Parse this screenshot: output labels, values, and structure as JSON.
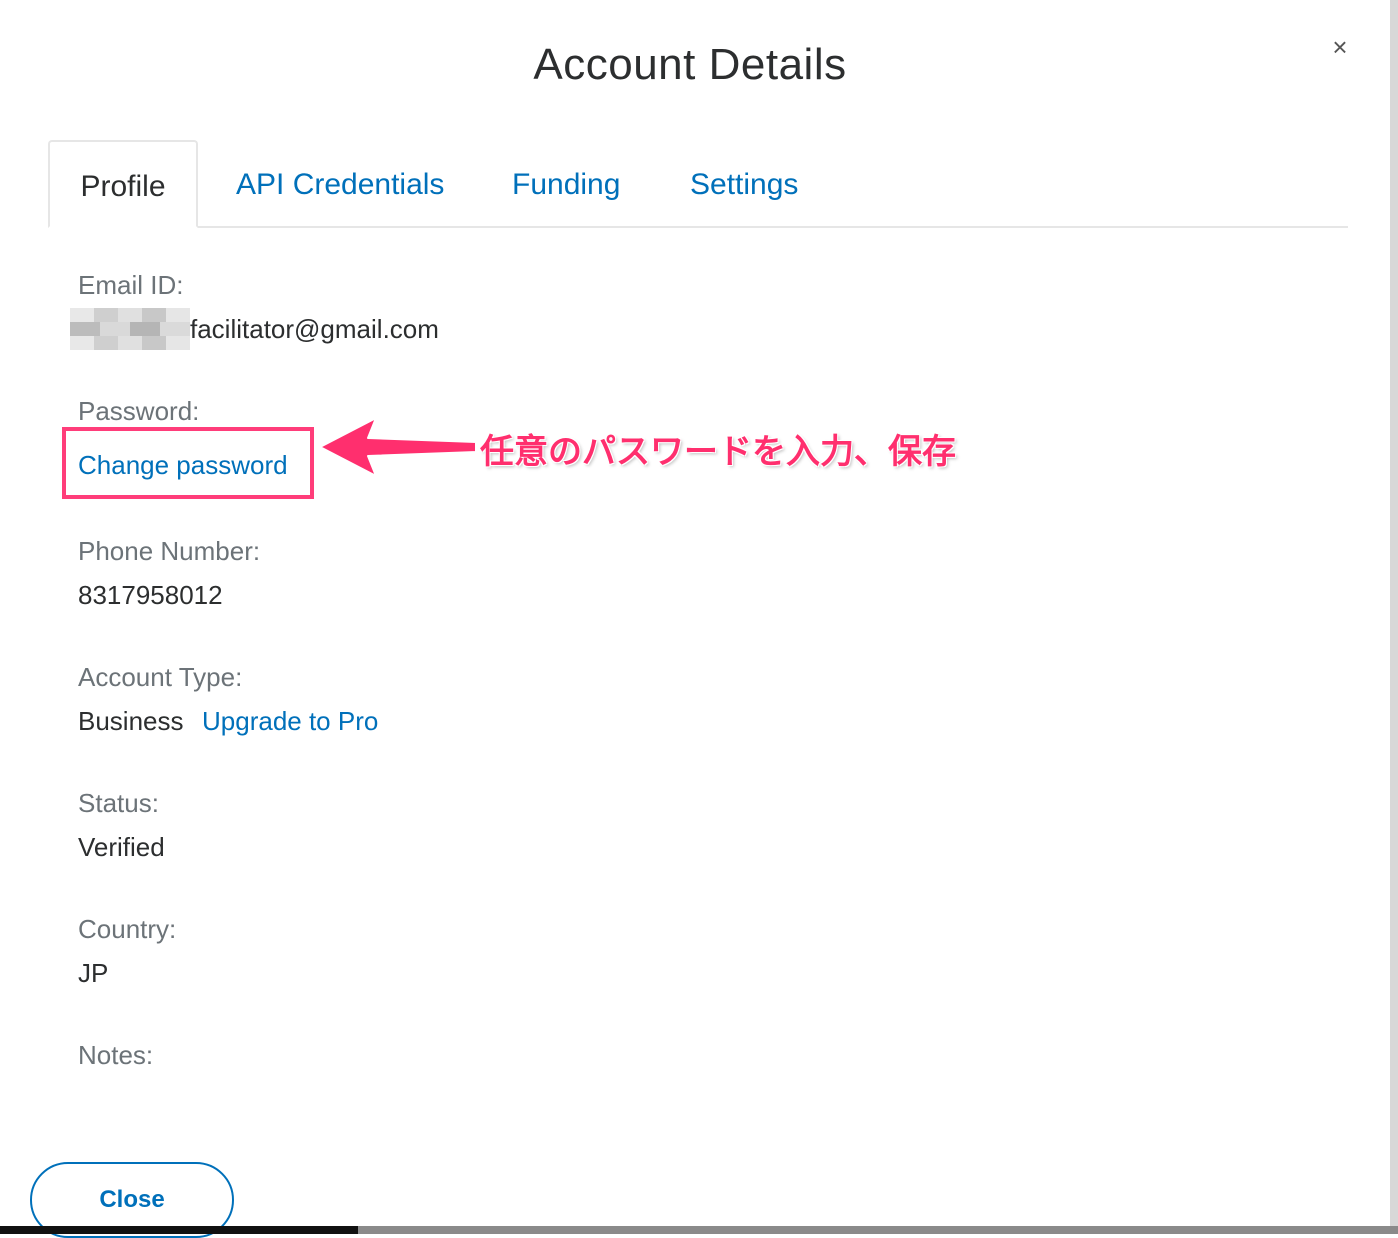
{
  "modal": {
    "title": "Account Details",
    "close_symbol": "×"
  },
  "tabs": [
    {
      "label": "Profile",
      "active": true
    },
    {
      "label": "API Credentials",
      "active": false
    },
    {
      "label": "Funding",
      "active": false
    },
    {
      "label": "Settings",
      "active": false
    }
  ],
  "profile": {
    "email_label": "Email ID:",
    "email_value": "facilitator@gmail.com",
    "password_label": "Password:",
    "change_password_link": "Change password",
    "phone_label": "Phone Number:",
    "phone_value": "8317958012",
    "account_type_label": "Account Type:",
    "account_type_value": "Business",
    "upgrade_link": "Upgrade to Pro",
    "status_label": "Status:",
    "status_value": "Verified",
    "country_label": "Country:",
    "country_value": "JP",
    "notes_label": "Notes:"
  },
  "annotation": {
    "text": "任意のパスワードを入力、保存",
    "color": "#ff2f6e"
  },
  "footer": {
    "close_button": "Close"
  },
  "colors": {
    "link": "#0070ba",
    "label": "#6c7378",
    "text": "#2c2e2f",
    "highlight": "#ff3d7a"
  }
}
